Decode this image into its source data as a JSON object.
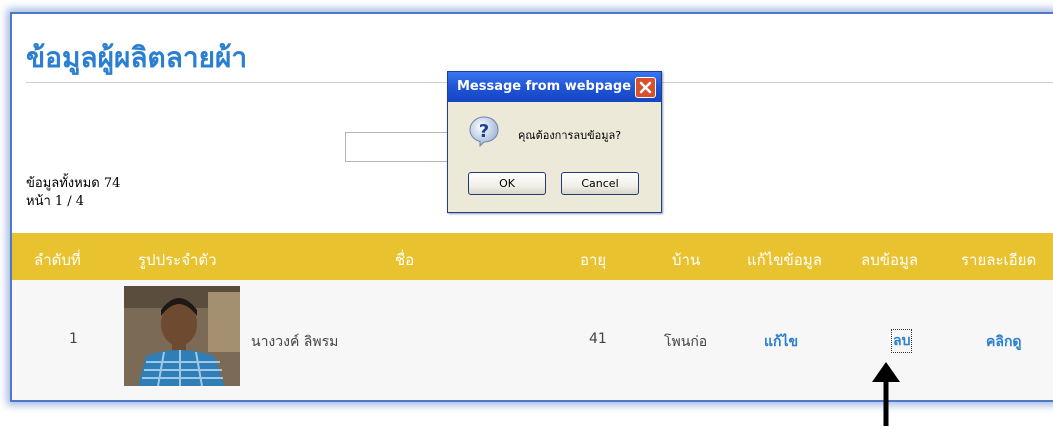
{
  "page": {
    "title": "ข้อมูลผู้ผลิตลายผ้า",
    "total_label": "ข้อมูลทั้งหมด 74",
    "page_label": "หน้า 1 / 4"
  },
  "table": {
    "headers": [
      "ลำดับที่",
      "รูปประจำตัว",
      "ชื่อ",
      "อายุ",
      "บ้าน",
      "แก้ไขข้อมูล",
      "ลบข้อมูล",
      "รายละเอียด"
    ],
    "rows": [
      {
        "no": "1",
        "name": "นางวงค์ ลิพรม",
        "age": "41",
        "village": "โพนก่อ",
        "edit": "แก้ไข",
        "delete": "ลบ",
        "detail": "คลิกดู"
      }
    ]
  },
  "dialog": {
    "title": "Message from webpage",
    "message": "คุณต้องการลบข้อมูล?",
    "ok_label": "OK",
    "cancel_label": "Cancel"
  },
  "colors": {
    "title": "#2a7fd1",
    "header_bg": "#e9c22f",
    "link": "#2a7fd1",
    "frame_border": "#4f78c8"
  },
  "icons": {
    "dialog_icon": "question-icon",
    "close_icon": "close-icon",
    "pointer": "arrow-up-icon"
  }
}
